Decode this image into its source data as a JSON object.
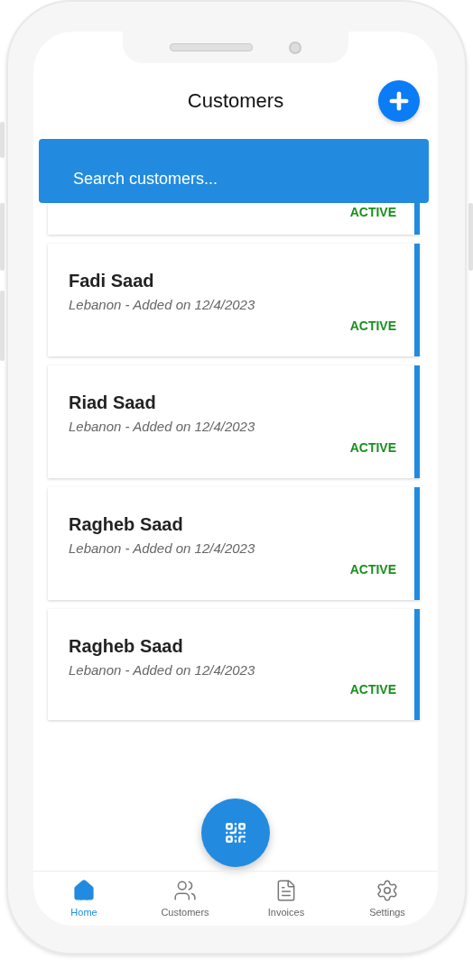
{
  "header": {
    "title": "Customers"
  },
  "search": {
    "placeholder": "Search customers..."
  },
  "partial_card": {
    "status": "ACTIVE"
  },
  "customers": [
    {
      "name": "Fadi Saad",
      "subtitle": "Lebanon - Added on 12/4/2023",
      "status": "ACTIVE"
    },
    {
      "name": "Riad Saad",
      "subtitle": "Lebanon - Added on 12/4/2023",
      "status": "ACTIVE"
    },
    {
      "name": "Ragheb Saad",
      "subtitle": "Lebanon - Added on 12/4/2023",
      "status": "ACTIVE"
    },
    {
      "name": "Ragheb Saad",
      "subtitle": "Lebanon - Added on 12/4/2023",
      "status": "ACTIVE"
    }
  ],
  "nav": [
    {
      "kind": "home",
      "label": "Home",
      "selected": true
    },
    {
      "kind": "people",
      "label": "Customers",
      "selected": false
    },
    {
      "kind": "document",
      "label": "Invoices",
      "selected": false
    },
    {
      "kind": "gear",
      "label": "Settings",
      "selected": false
    }
  ]
}
